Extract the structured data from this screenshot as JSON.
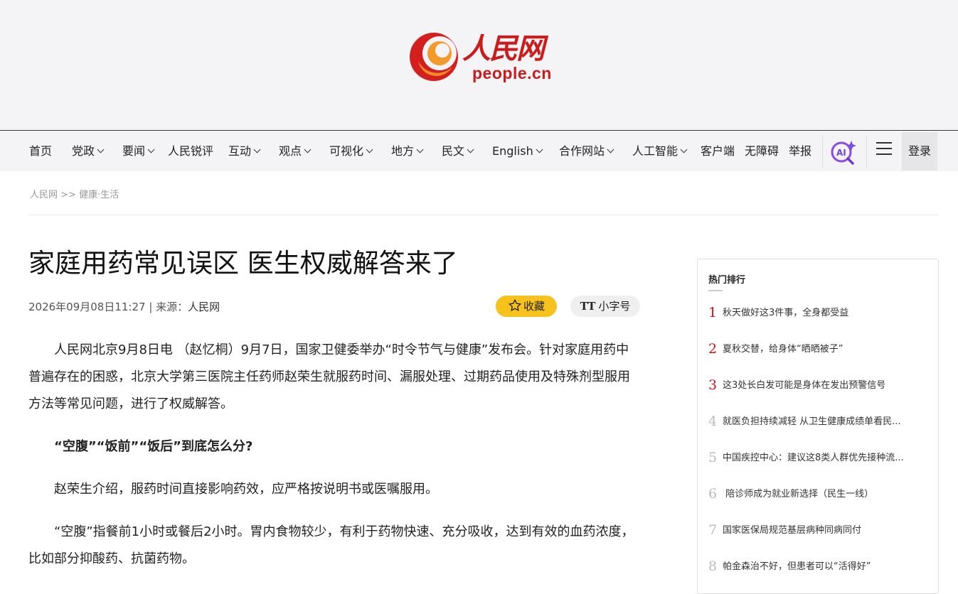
{
  "logo": {
    "name": "人民网",
    "sub": "people.cn"
  },
  "nav": {
    "items": [
      {
        "label": "首页",
        "dropdown": false
      },
      {
        "label": "党政",
        "dropdown": true
      },
      {
        "label": "要闻",
        "dropdown": true
      },
      {
        "label": "人民锐评",
        "dropdown": false
      },
      {
        "label": "互动",
        "dropdown": true
      },
      {
        "label": "观点",
        "dropdown": true
      },
      {
        "label": "可视化",
        "dropdown": true
      },
      {
        "label": "地方",
        "dropdown": true
      },
      {
        "label": "民文",
        "dropdown": true
      },
      {
        "label": "English",
        "dropdown": true
      },
      {
        "label": "合作网站",
        "dropdown": true
      },
      {
        "label": "人工智能",
        "dropdown": true
      },
      {
        "label": "客户端",
        "dropdown": false
      },
      {
        "label": "无障碍",
        "dropdown": false
      },
      {
        "label": "举报",
        "dropdown": false
      }
    ],
    "login": "登录"
  },
  "breadcrumb": {
    "home": "人民网",
    "sep": " >> ",
    "section": "健康·生活"
  },
  "article": {
    "title": "家庭用药常见误区 医生权威解答来了",
    "datetime": "2026年09月08日11:27",
    "source_prefix": " | 来源：",
    "source": "人民网",
    "fav_label": "收藏",
    "font_label": "小字号",
    "font_glyph": "TT",
    "paragraphs": [
      "人民网北京9月8日电 （赵忆桐）9月7日，国家卫健委举办“时令节气与健康”发布会。针对家庭用药中普遍存在的困惑，北京大学第三医院主任药师赵荣生就服药时间、漏服处理、过期药品使用及特殊剂型服用方法等常见问题，进行了权威解答。",
      "“空腹”“饭前”“饭后”到底怎么分?",
      "赵荣生介绍，服药时间直接影响药效，应严格按说明书或医嘱服用。",
      "“空腹”指餐前1小时或餐后2小时。胃内食物较少，有利于药物快速、充分吸收，达到有效的血药浓度，比如部分抑酸药、抗菌药物。"
    ]
  },
  "sidebar": {
    "title": "热门排行",
    "items": [
      {
        "rank": "1",
        "text": "秋天做好这3件事，全身都受益"
      },
      {
        "rank": "2",
        "text": "夏秋交替，给身体“晒晒被子”"
      },
      {
        "rank": "3",
        "text": "这3处长白发可能是身体在发出预警信号"
      },
      {
        "rank": "4",
        "text": "就医负担持续减轻 从卫生健康成绩单看民..."
      },
      {
        "rank": "5",
        "text": "中国疾控中心：建议这8类人群优先接种流..."
      },
      {
        "rank": "6",
        "text": " 陪诊师成为就业新选择（民生一线）"
      },
      {
        "rank": "7",
        "text": "国家医保局规范基层病种同病同付"
      },
      {
        "rank": "8",
        "text": "帕金森治不好，但患者可以“活得好”"
      }
    ]
  },
  "colors": {
    "brand_red": "#c8161d",
    "fav_yellow": "#f7c21b"
  }
}
